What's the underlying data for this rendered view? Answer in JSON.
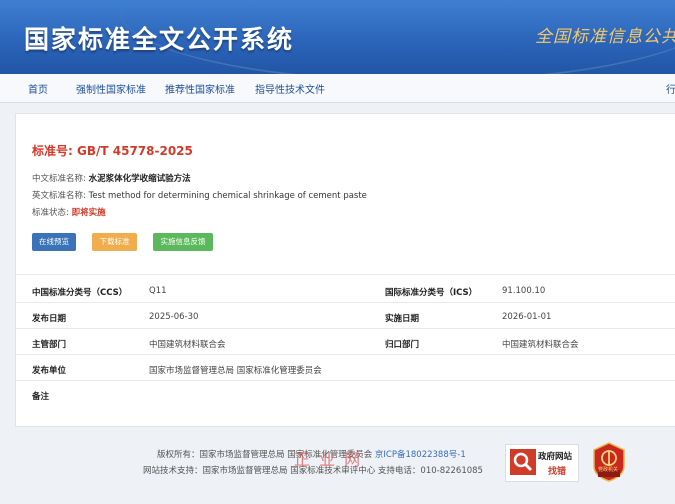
{
  "header": {
    "title": "国家标准全文公开系统",
    "slogan": "全国标准信息公共"
  },
  "nav": {
    "items": [
      "首页",
      "强制性国家标准",
      "推荐性国家标准",
      "指导性技术文件"
    ],
    "right_partial": "行"
  },
  "standard": {
    "number_label": "标准号:",
    "number": "GB/T 45778-2025",
    "cn_name_label": "中文标准名称:",
    "cn_name": "水泥浆体化学收缩试验方法",
    "en_name_label": "英文标准名称:",
    "en_name": "Test method for determining chemical shrinkage of cement paste",
    "status_label": "标准状态:",
    "status": "即将实施"
  },
  "buttons": {
    "preview": "在线预览",
    "download": "下载标准",
    "feedback": "实施信息反馈"
  },
  "colors": {
    "preview": "#3a73b8",
    "download": "#f0ad4e",
    "feedback": "#5cb85c",
    "accent_red": "#d13b2a"
  },
  "details": {
    "ccs_label": "中国标准分类号（CCS）",
    "ccs": "Q11",
    "ics_label": "国际标准分类号（ICS）",
    "ics": "91.100.10",
    "pub_date_label": "发布日期",
    "pub_date": "2025-06-30",
    "impl_date_label": "实施日期",
    "impl_date": "2026-01-01",
    "dept_label": "主管部门",
    "dept": "中国建筑材料联合会",
    "central_label": "归口部门",
    "central": "中国建筑材料联合会",
    "publisher_label": "发布单位",
    "publisher": "国家市场监督管理总局 国家标准化管理委员会",
    "remark_label": "备注",
    "remark": ""
  },
  "footer": {
    "copyright": "版权所有：国家市场监督管理总局 国家标准化管理委员会",
    "icp": "京ICP备18022388号-1",
    "support": "网站技术支持：国家市场监督管理总局 国家标准技术审评中心 支持电话：010-82261085",
    "watermark": "正 业 网",
    "badge_line1": "政府网站",
    "badge_line2": "找错",
    "emblem_caption": "党政机关"
  }
}
